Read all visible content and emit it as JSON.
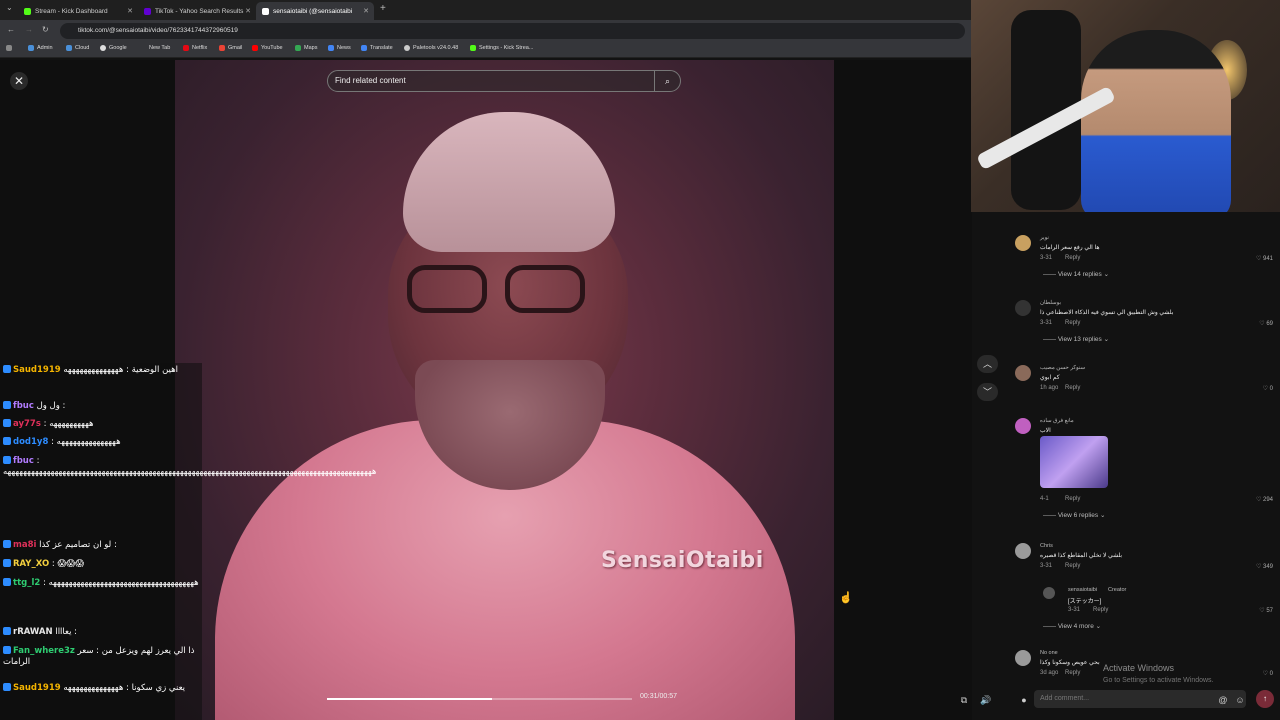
{
  "browser": {
    "tabs": [
      {
        "label": "Stream - Kick Dashboard",
        "color": "#53fc18"
      },
      {
        "label": "TikTok - Yahoo Search Results",
        "color": "#6001d2"
      },
      {
        "label": "sensaiotaibi (@sensaiotaibi",
        "color": "#ffffff"
      }
    ],
    "new_tab_symbol": "+",
    "url": "tiktok.com/@sensaiotaibi/video/7623341744372960519",
    "bookmarks": [
      "Admin",
      "Cloud",
      "Google",
      "New Tab",
      "Netflix",
      "Gmail",
      "YouTube",
      "Maps",
      "News",
      "Translate",
      "Paletools v24.0.48",
      "Settings - Kick Strea..."
    ]
  },
  "video": {
    "search_placeholder": "Find related content",
    "watermark": "SensaiOtaibi",
    "time": "00:31/00:57",
    "progress": 0.54
  },
  "chat": [
    {
      "user": "Saud1919",
      "user_color": "#f4b400",
      "text": "اهين الوضعية : ههههههههههههههه"
    },
    {
      "user": "fbuc",
      "user_color": "#b27cff",
      "text": "ول ول :"
    },
    {
      "user": "ay77s",
      "user_color": "#e0305a",
      "text": ": ههههههههههه"
    },
    {
      "user": "dod1y8",
      "user_color": "#2d8cff",
      "text": ": هههههههههههههههه"
    },
    {
      "user": "fbuc",
      "user_color": "#b27cff",
      "text": ": ههههههههههههههههههههههههههههههههههههههههههههههههههههههههههههههههههههههههههههههههههههههههههههههه"
    },
    {
      "user": "ma8i",
      "user_color": "#e0305a",
      "text": "لو ان تصاميم عز كذا :"
    },
    {
      "user": "RAY_XO",
      "user_color": "#f4d03f",
      "text": ": 😱😱😱"
    },
    {
      "user": "ttg_l2",
      "user_color": "#2ecc71",
      "text": ": هههههههههههههههههههههههههههههههههههههه"
    },
    {
      "user": "rRAWAN",
      "user_color": "#e8e8e8",
      "text": "يعاااا :"
    },
    {
      "user": "Fan_where3z",
      "user_color": "#2ecc71",
      "text": "ذا الي يعرز لهم ويزعل من : سعر الرامات"
    },
    {
      "user": "Saud1919",
      "user_color": "#f4b400",
      "text": "يعني زي سكونا : ههههههههههههههه"
    }
  ],
  "comments": [
    {
      "name": "نوير",
      "text": "ها الي رفع سعر الرامات",
      "date": "3-31",
      "reply": "Reply",
      "likes": "941",
      "view_replies": "View 14 replies"
    },
    {
      "name": "بوسلطان",
      "text": "بلشي وش التطبيق الي تسوي فيه الذكاء الاصطناعي ذا",
      "date": "3-31",
      "reply": "Reply",
      "likes": "69",
      "view_replies": "View 13 replies"
    },
    {
      "name": "سنوكر حسن مصيب",
      "text": "كم ابوي",
      "date": "1h ago",
      "reply": "Reply",
      "likes": "0"
    },
    {
      "name": "مانع فرق ساده",
      "text": "الاب",
      "date": "4-1",
      "reply": "Reply",
      "likes": "294",
      "view_replies": "View 6 replies"
    },
    {
      "name": "Chris",
      "text": "بلشي لا تخلي المقاطع كذا قصيره",
      "date": "3-31",
      "reply": "Reply",
      "likes": "349"
    },
    {
      "name": "sensaiotaibi",
      "badge": "Creator",
      "text": "[ステッカー]",
      "date": "3-31",
      "reply": "Reply",
      "likes": "57",
      "view_replies": "View 4 more"
    },
    {
      "name": "No one",
      "text": "بحي عويص وسكونا وكذا",
      "date": "3d ago",
      "reply": "Reply",
      "likes": "0"
    }
  ],
  "windows_watermark": {
    "title": "Activate Windows",
    "subtitle": "Go to Settings to activate Windows."
  },
  "comment_input": {
    "placeholder": "Add comment..."
  }
}
